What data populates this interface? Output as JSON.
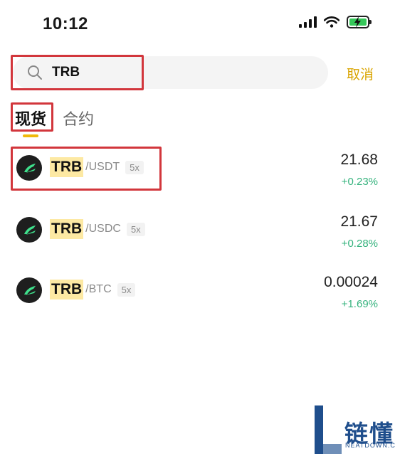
{
  "status_bar": {
    "time": "10:12"
  },
  "search": {
    "query": "TRB",
    "cancel_label": "取消"
  },
  "tabs": [
    {
      "label": "现货",
      "active": true
    },
    {
      "label": "合约",
      "active": false
    }
  ],
  "results": [
    {
      "base": "TRB",
      "quote": "/USDT",
      "leverage": "5x",
      "price": "21.68",
      "change": "+0.23%"
    },
    {
      "base": "TRB",
      "quote": "/USDC",
      "leverage": "5x",
      "price": "21.67",
      "change": "+0.28%"
    },
    {
      "base": "TRB",
      "quote": "/BTC",
      "leverage": "5x",
      "price": "0.00024",
      "change": "+1.69%"
    }
  ],
  "watermark": {
    "title": "链懂",
    "subtitle": "NEATDOWN.COM"
  },
  "colors": {
    "accent": "#f0b90b",
    "cancel": "#d9a400",
    "positive": "#36b37e",
    "highlight_box": "#d2363c"
  }
}
